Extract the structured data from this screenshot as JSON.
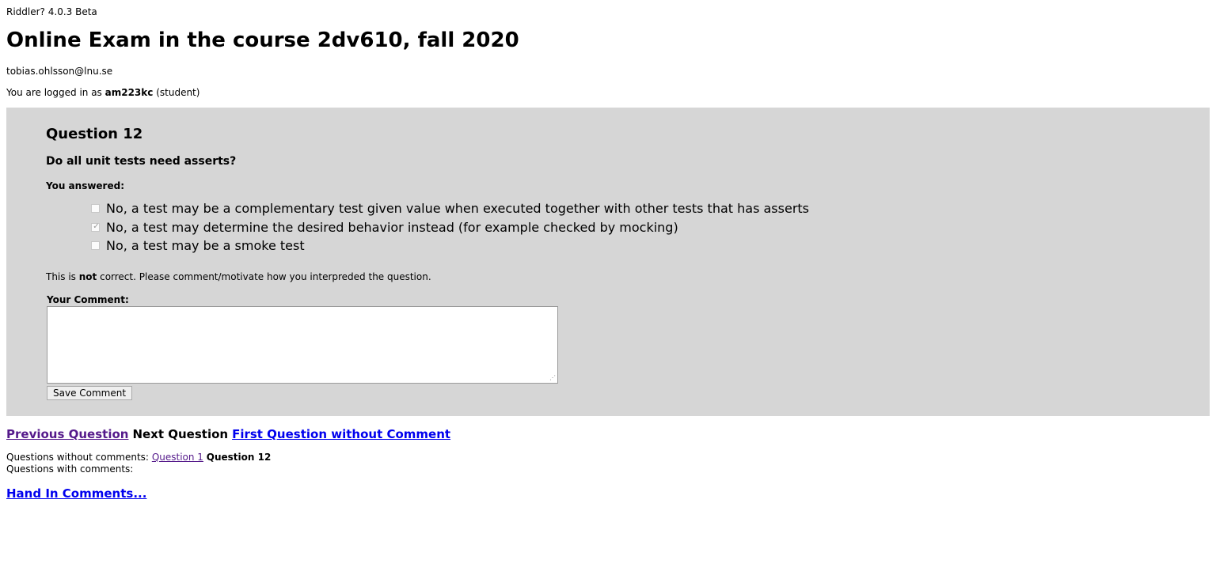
{
  "app": {
    "version": "Riddler? 4.0.3 Beta"
  },
  "page": {
    "title": "Online Exam in the course 2dv610, fall 2020",
    "email": "tobias.ohlsson@lnu.se",
    "login_prefix": "You are logged in as ",
    "username": "am223kc",
    "role": "(student)"
  },
  "question": {
    "title": "Question 12",
    "text": "Do all unit tests need asserts?",
    "answered_label": "You answered:",
    "options": [
      {
        "label": "No, a test may be a complementary test given value when executed together with other tests that has asserts",
        "checked": false
      },
      {
        "label": "No, a test may determine the desired behavior instead (for example checked by mocking)",
        "checked": true
      },
      {
        "label": "No, a test may be a smoke test",
        "checked": false
      }
    ],
    "feedback_prefix": "This is ",
    "feedback_emphasis": "not",
    "feedback_suffix": " correct. Please comment/motivate how you interpreded the question.",
    "comment_label": "Your Comment:",
    "comment_value": "",
    "save_label": "Save Comment"
  },
  "nav": {
    "previous": "Previous Question",
    "next": "Next Question",
    "first_without_comment": "First Question without Comment"
  },
  "comments_status": {
    "without_label": "Questions without comments:",
    "without_link": "Question 1",
    "without_current": "Question 12",
    "with_label": "Questions with comments:"
  },
  "hand_in": {
    "label": "Hand In Comments..."
  }
}
